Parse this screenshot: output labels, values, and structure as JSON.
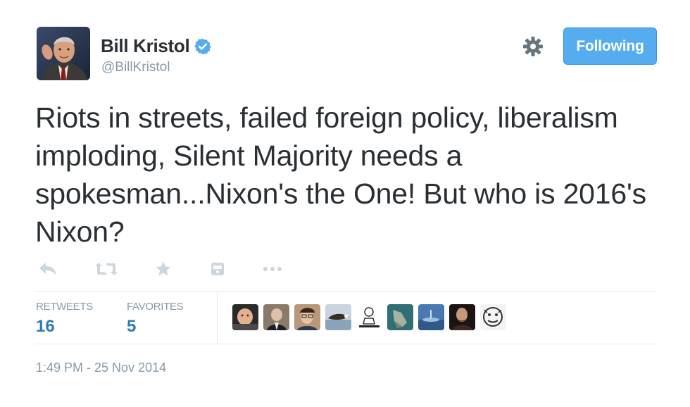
{
  "user": {
    "display_name": "Bill Kristol",
    "handle": "@BillKristol",
    "verified_icon": "verified-badge-icon",
    "avatar_icon": "profile-photo"
  },
  "header": {
    "settings_icon": "gear-icon",
    "follow_button_label": "Following"
  },
  "tweet": {
    "text": "Riots in streets, failed foreign policy, liberalism imploding, Silent Majority needs a spokesman...Nixon's the One! But who is 2016's Nixon?",
    "actions": [
      {
        "icon": "reply-icon"
      },
      {
        "icon": "retweet-icon"
      },
      {
        "icon": "favorite-star-icon"
      },
      {
        "icon": "embed-icon"
      },
      {
        "icon": "more-dots-icon"
      }
    ]
  },
  "stats": {
    "retweets_label": "RETWEETS",
    "retweets_value": "16",
    "favorites_label": "FAVORITES",
    "favorites_value": "5"
  },
  "timestamp": "1:49 PM - 25 Nov 2014",
  "colors": {
    "accent": "#55acee",
    "link": "#2b7bb9",
    "muted": "#8899a6",
    "text": "#292f33",
    "border": "#e1e8ed"
  }
}
